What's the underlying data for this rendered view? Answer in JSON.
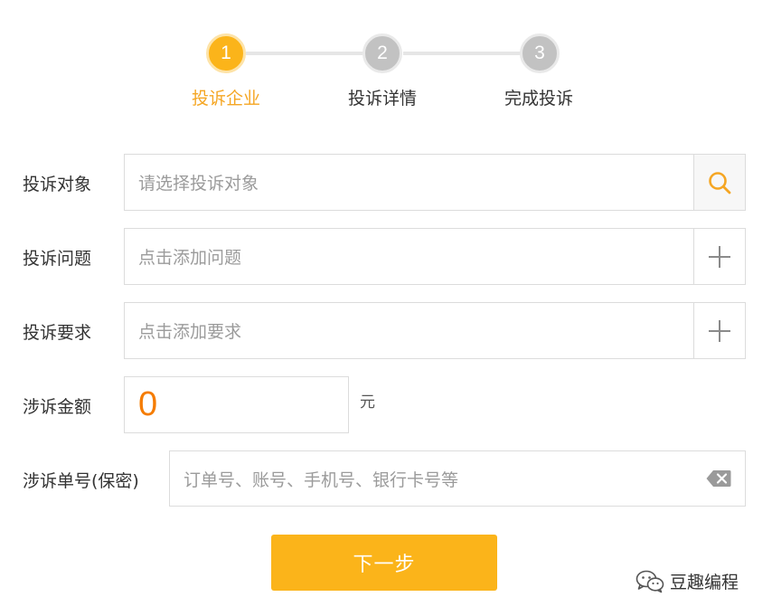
{
  "stepper": {
    "steps": [
      {
        "number": "1",
        "label": "投诉企业",
        "state": "active"
      },
      {
        "number": "2",
        "label": "投诉详情",
        "state": "inactive"
      },
      {
        "number": "3",
        "label": "完成投诉",
        "state": "inactive"
      }
    ]
  },
  "form": {
    "target": {
      "label": "投诉对象",
      "placeholder": "请选择投诉对象",
      "icon": "search-icon"
    },
    "issue": {
      "label": "投诉问题",
      "placeholder": "点击添加问题",
      "icon": "plus-icon"
    },
    "demand": {
      "label": "投诉要求",
      "placeholder": "点击添加要求",
      "icon": "plus-icon"
    },
    "amount": {
      "label": "涉诉金额",
      "value": "0",
      "unit": "元"
    },
    "order_no": {
      "label": "涉诉单号(保密)",
      "placeholder": "订单号、账号、手机号、银行卡号等",
      "icon": "clear-icon"
    }
  },
  "next_button": {
    "label": "下一步"
  },
  "watermark": {
    "text": "豆趣编程"
  },
  "colors": {
    "accent": "#fbb41a",
    "accent_text": "#f5a623",
    "amount": "#f57c00",
    "inactive_step": "#c2c2c2"
  }
}
